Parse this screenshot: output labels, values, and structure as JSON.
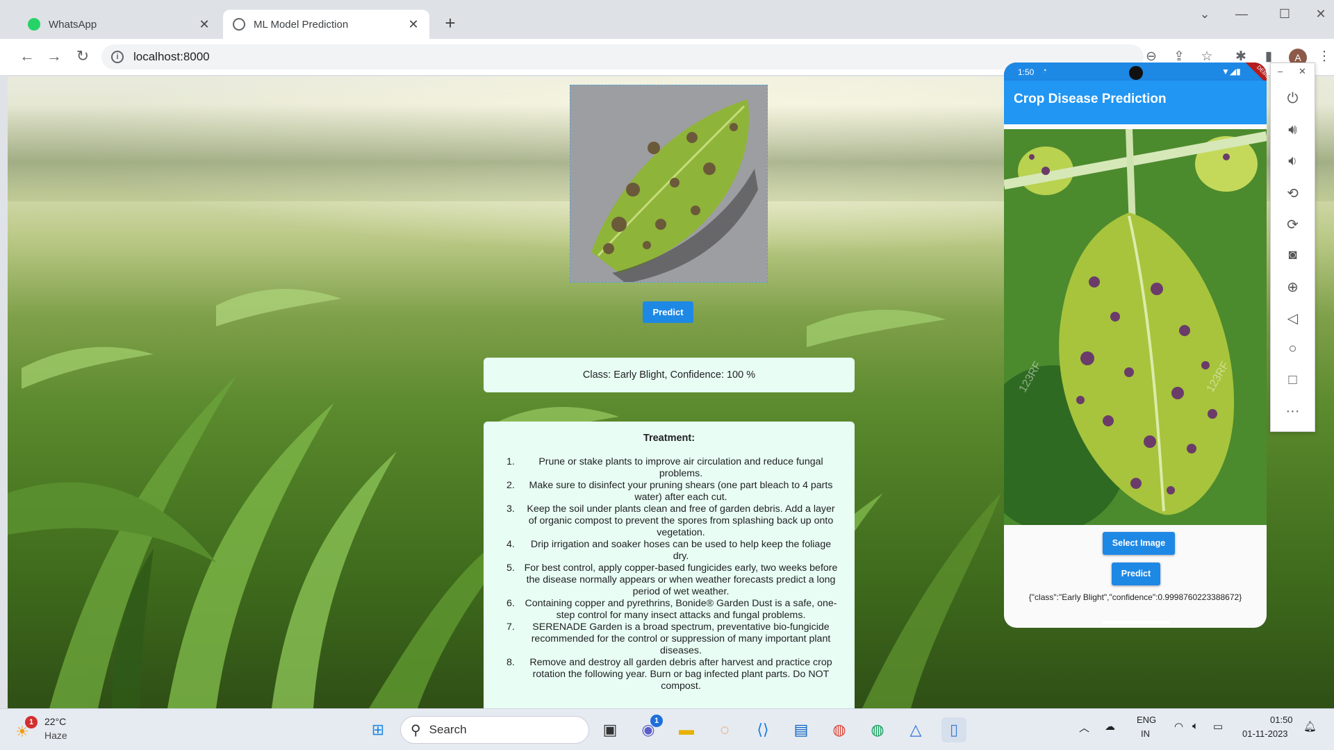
{
  "browser": {
    "tabs": [
      {
        "title": "WhatsApp",
        "icon": "whatsapp-icon",
        "active": false
      },
      {
        "title": "ML Model Prediction",
        "icon": "globe-icon",
        "active": true
      }
    ],
    "url": "localhost:8000"
  },
  "page": {
    "predict_label": "Predict",
    "result_text": "Class: Early Blight, Confidence: 100 %",
    "treatment_title": "Treatment:",
    "treatments": [
      {
        "num": "1.",
        "text": "Prune or stake plants to improve air circulation and reduce fungal problems."
      },
      {
        "num": "2.",
        "text": "Make sure to disinfect your pruning shears (one part bleach to 4 parts water) after each cut."
      },
      {
        "num": "3.",
        "text": "Keep the soil under plants clean and free of garden debris. Add a layer of organic compost to prevent the spores from splashing back up onto vegetation."
      },
      {
        "num": "4.",
        "text": "Drip irrigation and soaker hoses can be used to help keep the foliage dry."
      },
      {
        "num": "5.",
        "text": "For best control, apply copper-based fungicides early, two weeks before the disease normally appears or when weather forecasts predict a long period of wet weather."
      },
      {
        "num": "6.",
        "text": "Containing copper and pyrethrins, Bonide® Garden Dust is a safe, one-step control for many insect attacks and fungal problems."
      },
      {
        "num": "7.",
        "text": "SERENADE Garden is a broad spectrum, preventative bio-fungicide recommended for the control or suppression of many important plant diseases."
      },
      {
        "num": "8.",
        "text": "Remove and destroy all garden debris after harvest and practice crop rotation the following year. Burn or bag infected plant parts. Do NOT compost."
      }
    ]
  },
  "emulator": {
    "status_time": "1:50",
    "debug_banner": "DEBUG",
    "app_title": "Crop Disease Prediction",
    "select_image_label": "Select Image",
    "predict_label": "Predict",
    "response_json": "{\"class\":\"Early Blight\",\"confidence\":0.9998760223388672}",
    "watermark": "123RF",
    "side_controls": [
      "power-icon",
      "volume-up-icon",
      "volume-down-icon",
      "rotate-left-icon",
      "rotate-right-icon",
      "camera-icon",
      "zoom-icon",
      "back-icon",
      "home-icon",
      "overview-icon",
      "more-icon"
    ]
  },
  "taskbar": {
    "weather_temp": "22°C",
    "weather_desc": "Haze",
    "weather_badge": "1",
    "search_label": "Search",
    "teams_badge": "1",
    "lang_line1": "ENG",
    "lang_line2": "IN",
    "time": "01:50",
    "date": "01-11-2023"
  },
  "colors": {
    "accent_blue": "#1e88e5",
    "card_bg": "#e8fdf4",
    "app_bar": "#2196f3"
  }
}
